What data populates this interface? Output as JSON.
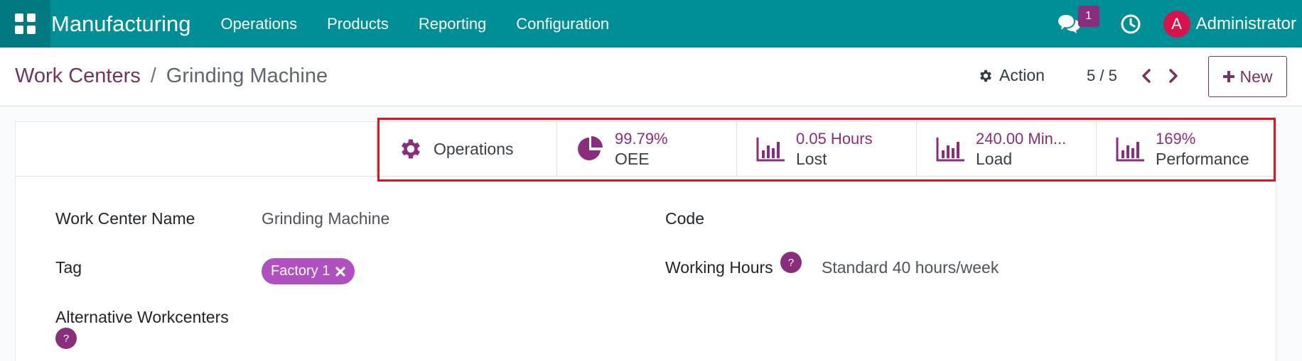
{
  "navbar": {
    "app_title": "Manufacturing",
    "menu": [
      "Operations",
      "Products",
      "Reporting",
      "Configuration"
    ],
    "chat_count": "1",
    "avatar_letter": "A",
    "user_name": "Administrator",
    "bg_color": "#008f96"
  },
  "control": {
    "breadcrumb_parent": "Work Centers",
    "breadcrumb_sep": "/",
    "breadcrumb_current": "Grinding Machine",
    "action_label": "Action",
    "pager": "5 / 5",
    "new_label": "New"
  },
  "stat_buttons": {
    "operations": {
      "label": "Operations",
      "icon": "gear-icon"
    },
    "oee": {
      "value": "99.79%",
      "label": "OEE",
      "icon": "pie-chart-icon"
    },
    "lost": {
      "value": "0.05 Hours",
      "label": "Lost",
      "icon": "bar-chart-icon"
    },
    "load": {
      "value": "240.00 Min...",
      "label": "Load",
      "icon": "bar-chart-icon"
    },
    "performance": {
      "value": "169%",
      "label": "Performance",
      "icon": "bar-chart-icon"
    }
  },
  "form": {
    "work_center_name_label": "Work Center Name",
    "work_center_name_value": "Grinding Machine",
    "code_label": "Code",
    "tag_label": "Tag",
    "tag_value": "Factory 1",
    "working_hours_label": "Working Hours",
    "working_hours_value": "Standard 40 hours/week",
    "alt_workcenters_label": "Alternative Workcenters",
    "help_mark": "?"
  }
}
